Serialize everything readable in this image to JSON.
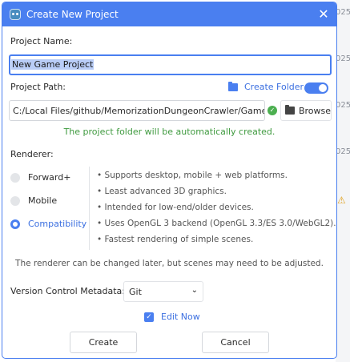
{
  "dialog": {
    "title": "Create New Project",
    "project_name_label": "Project Name:",
    "project_name_value": "New Game Project",
    "project_path_label": "Project Path:",
    "create_folder_label": "Create Folder",
    "create_folder_enabled": true,
    "project_path_value": "C:/Local Files/github/MemorizationDungeonCrawler/Game/",
    "browse_label": "Browse",
    "status_message": "The project folder will be automatically created.",
    "renderer_label": "Renderer:",
    "renderers": [
      {
        "label": "Forward+",
        "selected": false
      },
      {
        "label": "Mobile",
        "selected": false
      },
      {
        "label": "Compatibility",
        "selected": true
      }
    ],
    "renderer_features": [
      "•  Supports desktop, mobile + web platforms.",
      "•  Least advanced 3D graphics.",
      "•  Intended for low-end/older devices.",
      "•  Uses OpenGL 3 backend (OpenGL 3.3/ES 3.0/WebGL2).",
      "•  Fastest rendering of simple scenes."
    ],
    "renderer_note": "The renderer can be changed later, but scenes may need to be adjusted.",
    "vcs_label": "Version Control Metadata:",
    "vcs_value": "Git",
    "edit_now_label": "Edit Now",
    "edit_now_checked": true,
    "create_label": "Create",
    "cancel_label": "Cancel"
  },
  "background": {
    "row_fragments": [
      "025",
      "025",
      "025",
      "025"
    ]
  },
  "icons": [
    "godot-app-icon",
    "close-icon",
    "folder-icon",
    "check-icon",
    "chevron-down-icon",
    "warning-icon"
  ],
  "colors": {
    "accent": "#4a7ff0",
    "success": "#3f9a3f",
    "warning": "#e0a220"
  }
}
